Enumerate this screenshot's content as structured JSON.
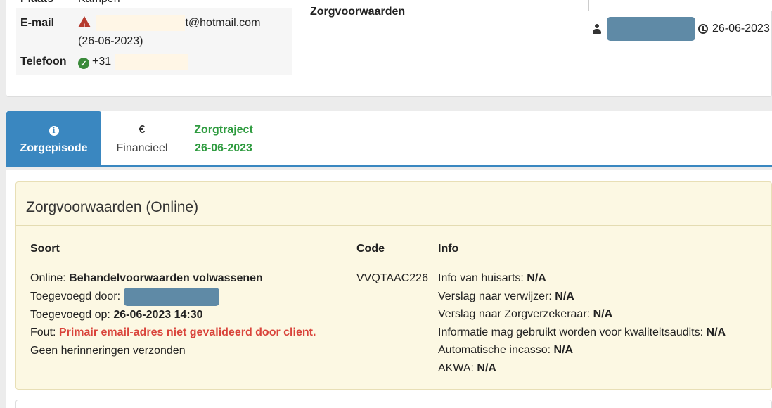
{
  "client": {
    "plaats_label": "Plaats",
    "plaats_value": "Kampen",
    "email_label": "E-mail",
    "email_suffix": "t@hotmail.com",
    "email_date": "(26-06-2023)",
    "telefoon_label": "Telefoon",
    "telefoon_prefix": "+31"
  },
  "header": {
    "zorgvoorwaarden_label": "Zorgvoorwaarden",
    "date": "26-06-2023"
  },
  "tabs": [
    {
      "label": "Zorgepisode",
      "icon": "info-icon",
      "active": true
    },
    {
      "label": "Financieel",
      "icon": "euro-icon"
    },
    {
      "label_line1": "Zorgtraject",
      "label_line2": "26-06-2023"
    }
  ],
  "panel": {
    "title": "Zorgvoorwaarden (Online)",
    "columns": [
      "Soort",
      "Code",
      "Info"
    ],
    "soort": {
      "online_label": "Online:",
      "online_value": "Behandelvoorwaarden volwassenen",
      "added_by_label": "Toegevoegd door:",
      "added_on_label": "Toegevoegd op:",
      "added_on_value": "26-06-2023 14:30",
      "error_label": "Fout:",
      "error_value": "Primair email-adres niet gevalideerd door client.",
      "reminders": "Geen herinneringen verzonden"
    },
    "code": "VVQTAAC226",
    "info": [
      {
        "label": "Info van huisarts:",
        "value": "N/A"
      },
      {
        "label": "Verslag naar verwijzer:",
        "value": "N/A"
      },
      {
        "label": "Verslag naar Zorgverzekeraar:",
        "value": "N/A"
      },
      {
        "label": "Informatie mag gebruikt worden voor kwaliteitsaudits:",
        "value": "N/A"
      },
      {
        "label": "Automatische incasso:",
        "value": "N/A"
      },
      {
        "label": "AKWA:",
        "value": "N/A"
      }
    ]
  },
  "colors": {
    "primary": "#3a87c0",
    "success": "#2e9b3f",
    "danger": "#d9443b",
    "warning_bg": "#fcf8e3"
  }
}
